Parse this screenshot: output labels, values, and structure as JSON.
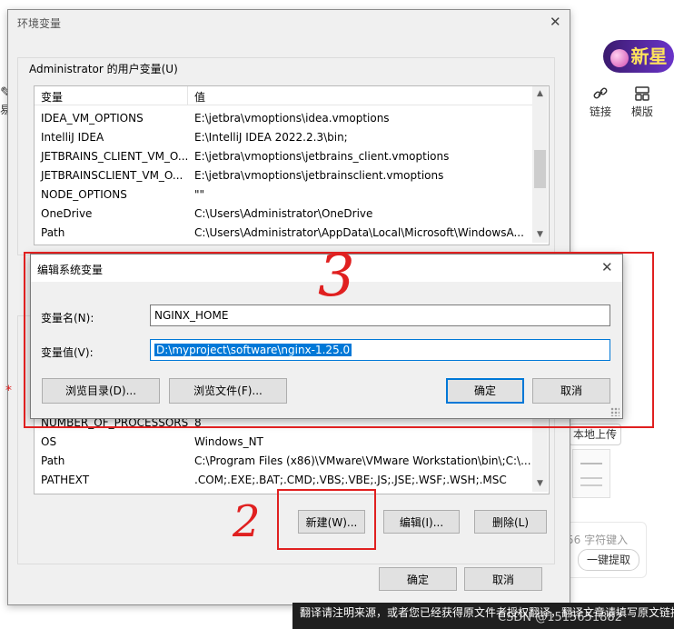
{
  "background_app": {
    "banner_text": "新星",
    "toolbar": [
      {
        "icon": "link-icon",
        "label": "链接"
      },
      {
        "icon": "template-icon",
        "label": "模版"
      }
    ],
    "local_upload_label": "本地上传",
    "char_count_text": "56 字符键入",
    "one_key_extract_label": "一键提取",
    "left_edge_text": "易",
    "toast_text": "翻译请注明来源，或者您已经获得原文件者授权翻译，翻译文章请填写原文链接",
    "watermark": "CSDN @1515651882"
  },
  "env_dialog": {
    "title": "环境变量",
    "user_vars_label": "Administrator 的用户变量(U)",
    "columns": {
      "name": "变量",
      "value": "值"
    },
    "user_vars": [
      {
        "name": "IDEA_VM_OPTIONS",
        "value": "E:\\jetbra\\vmoptions\\idea.vmoptions"
      },
      {
        "name": "IntelliJ IDEA",
        "value": "E:\\IntelliJ IDEA 2022.2.3\\bin;"
      },
      {
        "name": "JETBRAINS_CLIENT_VM_O...",
        "value": "E:\\jetbra\\vmoptions\\jetbrains_client.vmoptions"
      },
      {
        "name": "JETBRAINSCLIENT_VM_O...",
        "value": "E:\\jetbra\\vmoptions\\jetbrainsclient.vmoptions"
      },
      {
        "name": "NODE_OPTIONS",
        "value": "\"\""
      },
      {
        "name": "OneDrive",
        "value": "C:\\Users\\Administrator\\OneDrive"
      },
      {
        "name": "Path",
        "value": "C:\\Users\\Administrator\\AppData\\Local\\Microsoft\\WindowsA..."
      }
    ],
    "system_vars": [
      {
        "name": "NUMBER_OF_PROCESSORS",
        "value": "8"
      },
      {
        "name": "OS",
        "value": "Windows_NT"
      },
      {
        "name": "Path",
        "value": "C:\\Program Files (x86)\\VMware\\VMware Workstation\\bin\\;C:\\..."
      },
      {
        "name": "PATHEXT",
        "value": ".COM;.EXE;.BAT;.CMD;.VBS;.VBE;.JS;.JSE;.WSF;.WSH;.MSC"
      }
    ],
    "buttons": {
      "new": "新建(W)...",
      "edit": "编辑(I)...",
      "delete": "删除(L)",
      "ok": "确定",
      "cancel": "取消"
    }
  },
  "edit_dialog": {
    "title": "编辑系统变量",
    "name_label": "变量名(N):",
    "name_value": "NGINX_HOME",
    "value_label": "变量值(V):",
    "value_value": "D:\\myproject\\software\\nginx-1.25.0",
    "buttons": {
      "browse_dir": "浏览目录(D)...",
      "browse_file": "浏览文件(F)...",
      "ok": "确定",
      "cancel": "取消"
    }
  },
  "annotations": {
    "step2": "2",
    "step3": "3"
  },
  "colors": {
    "annotation_red": "#e02020",
    "selection_blue": "#0078d7"
  }
}
